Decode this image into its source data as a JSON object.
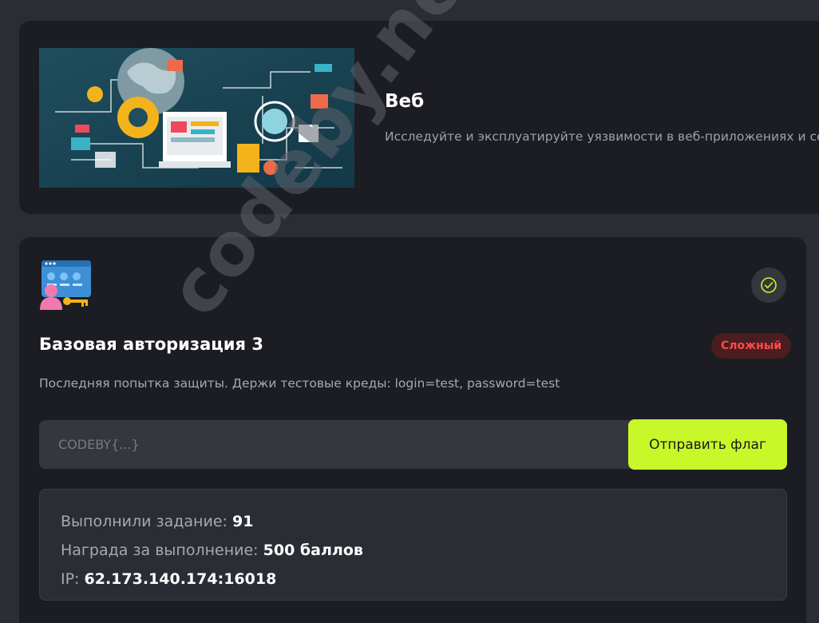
{
  "category": {
    "title": "Веб",
    "description": "Исследуйте и эксплуатируйте уязвимости в веб-приложениях и се"
  },
  "task": {
    "title": "Базовая авторизация 3",
    "difficulty": "Сложный",
    "description": "Последняя попытка защиты. Держи тестовые креды: login=test, password=test",
    "flag_input": {
      "placeholder": "CODEBY{...}",
      "value": ""
    },
    "submit_label": "Отправить флаг",
    "stats": {
      "solved_label": "Выполнили задание:",
      "solved_value": "91",
      "reward_label": "Награда за выполнение:",
      "reward_value": "500 баллов",
      "ip_label": "IP:",
      "ip_value": "62.173.140.174:16018"
    }
  },
  "watermark": "codeby.net",
  "colors": {
    "background": "#2a2d33",
    "card": "#1c1d22",
    "accent": "#c8f72a",
    "difficulty_text": "#ff4a4a",
    "difficulty_bg": "#4a1d20"
  }
}
